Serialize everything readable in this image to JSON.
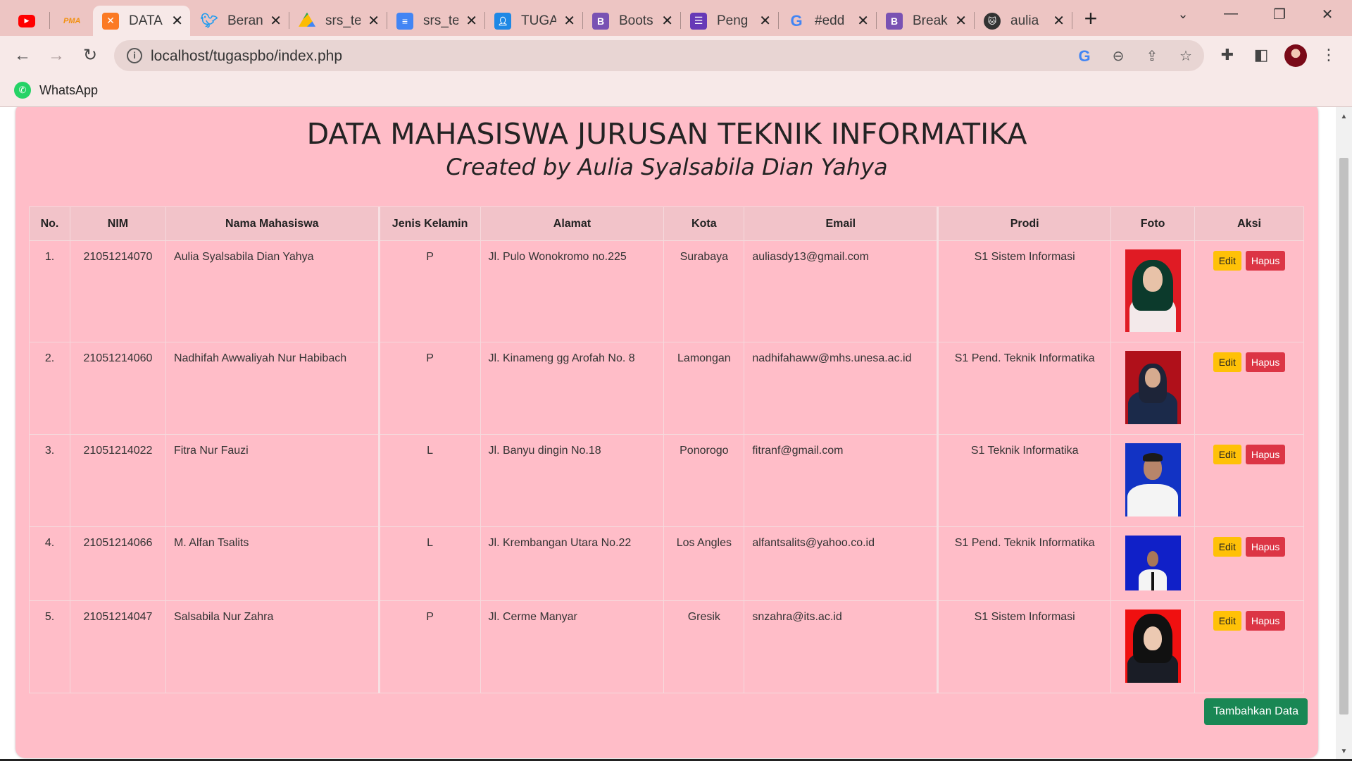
{
  "browser": {
    "tabs": [
      {
        "title": "",
        "icon": "youtube-icon",
        "color": "#ff0000"
      },
      {
        "title": "",
        "icon": "pma-icon",
        "color": "#f29111"
      },
      {
        "title": "DATA",
        "icon": "xampp-icon",
        "color": "#fb7a24",
        "active": true
      },
      {
        "title": "Beran",
        "icon": "twitter-icon",
        "color": "#1d9bf0"
      },
      {
        "title": "srs_te",
        "icon": "google-drive-icon",
        "color": "#34a853"
      },
      {
        "title": "srs_te",
        "icon": "google-docs-icon",
        "color": "#4285f4"
      },
      {
        "title": "TUGA",
        "icon": "google-classroom-icon",
        "color": "#1e88e5"
      },
      {
        "title": "Boots",
        "icon": "bootstrap-icon",
        "color": "#7952b3"
      },
      {
        "title": "Peng",
        "icon": "google-forms-icon",
        "color": "#673ab7"
      },
      {
        "title": "#edd",
        "icon": "google-icon",
        "color": "#4285f4"
      },
      {
        "title": "Break",
        "icon": "bootstrap-icon",
        "color": "#7952b3"
      },
      {
        "title": "aulia",
        "icon": "github-icon",
        "color": "#333333"
      }
    ],
    "pma_label": "PMA",
    "url": "localhost/tugaspbo/index.php",
    "bookmark": "WhatsApp"
  },
  "page": {
    "title": "DATA MAHASISWA JURUSAN TEKNIK INFORMATIKA",
    "subtitle": "Created by Aulia Syalsabila Dian Yahya",
    "columns": [
      "No.",
      "NIM",
      "Nama Mahasiswa",
      "Jenis Kelamin",
      "Alamat",
      "Kota",
      "Email",
      "Prodi",
      "Foto",
      "Aksi"
    ],
    "rows": [
      {
        "no": "1.",
        "nim": "21051214070",
        "nama": "Aulia Syalsabila Dian Yahya",
        "jk": "P",
        "alamat": "Jl. Pulo Wonokromo no.225",
        "kota": "Surabaya",
        "email": "auliasdy13@gmail.com",
        "prodi": "S1 Sistem Informasi",
        "photo_bg": "#e01b24"
      },
      {
        "no": "2.",
        "nim": "21051214060",
        "nama": "Nadhifah Awwaliyah Nur Habibach",
        "jk": "P",
        "alamat": "Jl. Kinameng gg Arofah No. 8",
        "kota": "Lamongan",
        "email": "nadhifahaww@mhs.unesa.ac.id",
        "prodi": "S1 Pend. Teknik Informatika",
        "photo_bg": "#b0101a"
      },
      {
        "no": "3.",
        "nim": "21051214022",
        "nama": "Fitra Nur Fauzi",
        "jk": "L",
        "alamat": "Jl. Banyu dingin No.18",
        "kota": "Ponorogo",
        "email": "fitranf@gmail.com",
        "prodi": "S1 Teknik Informatika",
        "photo_bg": "#1233c4"
      },
      {
        "no": "4.",
        "nim": "21051214066",
        "nama": "M. Alfan Tsalits",
        "jk": "L",
        "alamat": "Jl. Krembangan Utara No.22",
        "kota": "Los Angles",
        "email": "alfantsalits@yahoo.co.id",
        "prodi": "S1 Pend. Teknik Informatika",
        "photo_bg": "#1020c8"
      },
      {
        "no": "5.",
        "nim": "21051214047",
        "nama": "Salsabila Nur Zahra",
        "jk": "P",
        "alamat": "Jl. Cerme Manyar",
        "kota": "Gresik",
        "email": "snzahra@its.ac.id",
        "prodi": "S1 Sistem Informasi",
        "photo_bg": "#f01010"
      }
    ],
    "edit_label": "Edit",
    "delete_label": "Hapus",
    "add_label": "Tambahkan Data"
  }
}
